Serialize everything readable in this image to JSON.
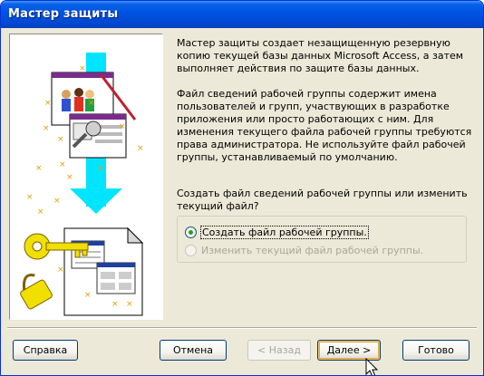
{
  "window": {
    "title": "Мастер защиты"
  },
  "description": {
    "para1": "Мастер защиты создает незащищенную резервную копию текущей базы данных Microsoft Access, а затем выполняет действия по защите базы данных.",
    "para2": "Файл сведений рабочей группы содержит имена пользователей и групп, участвующих в разработке приложения или просто работающих с ним. Для изменения текущего файла рабочей группы требуются права администратора. Не используйте файл рабочей группы, устанавливаемый по умолчанию."
  },
  "question": "Создать файл сведений рабочей группы или изменить текущий файл?",
  "options": [
    {
      "label": "Создать файл рабочей группы.",
      "checked": true,
      "enabled": true
    },
    {
      "label": "Изменить текущий файл рабочей группы.",
      "checked": false,
      "enabled": false
    }
  ],
  "buttons": {
    "help": "Справка",
    "cancel": "Отмена",
    "back": "< Назад",
    "next": "Далее >",
    "finish": "Готово"
  },
  "colors": {
    "titlebar": "#0054e3",
    "accent_cyan": "#00e5ff",
    "key_yellow": "#f0e000",
    "dialog_bg": "#ece9d8"
  },
  "icons": [
    "wizard-illustration",
    "mouse-pointer-icon"
  ]
}
